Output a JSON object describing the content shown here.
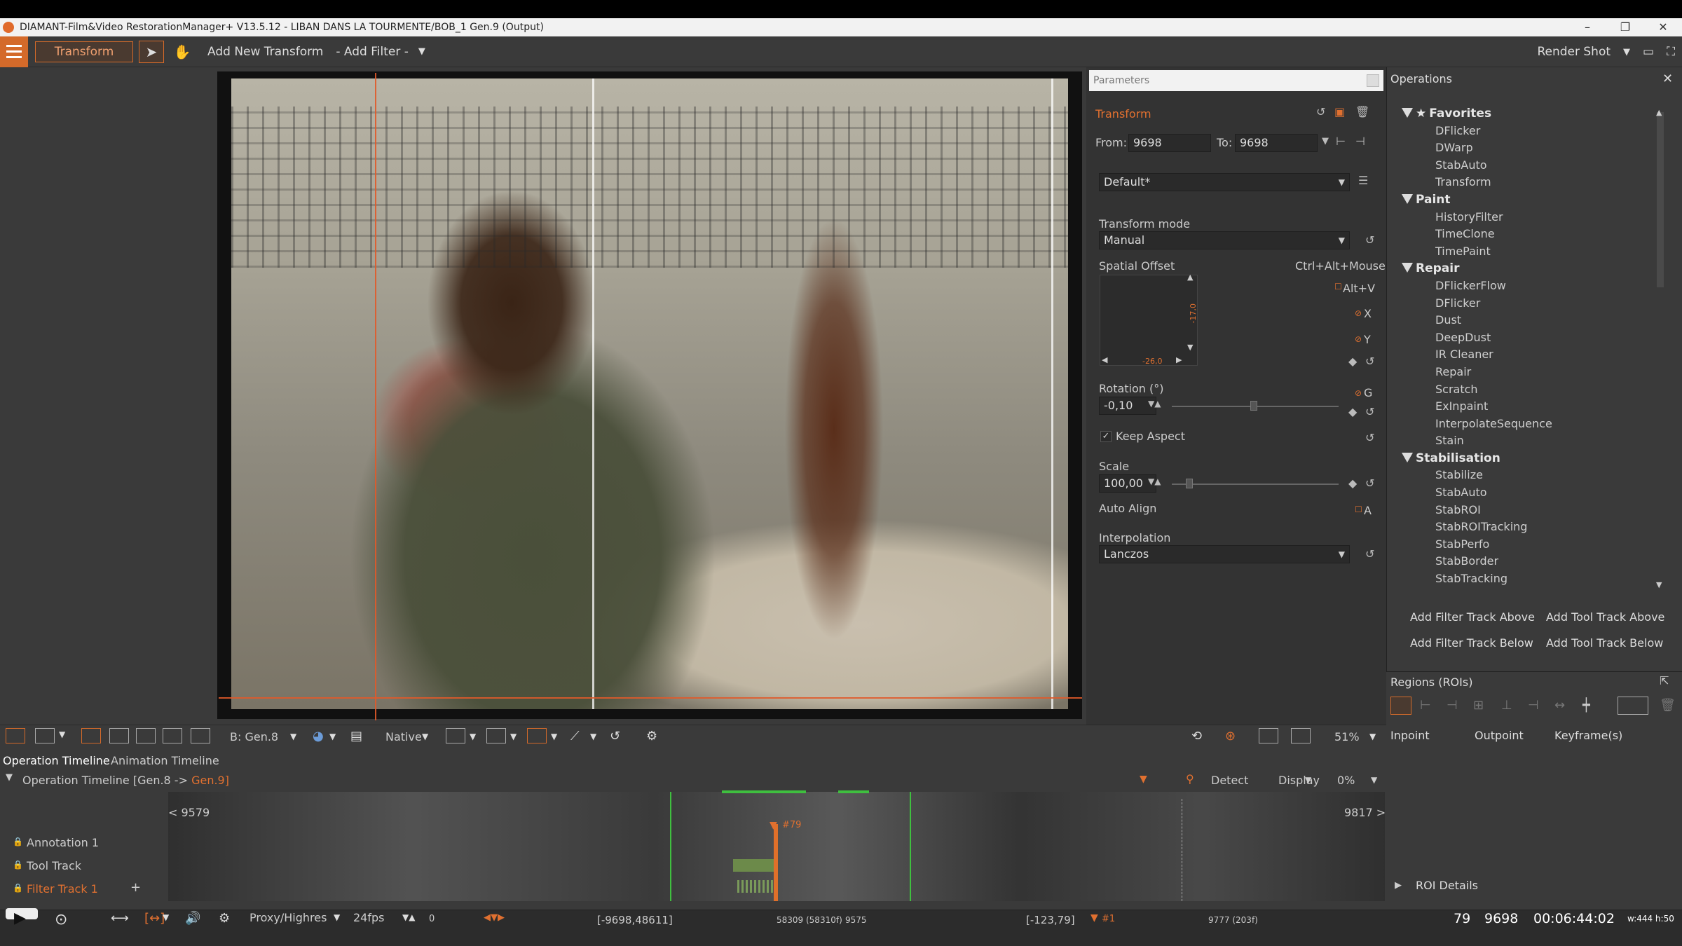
{
  "window": {
    "title": "DIAMANT-Film&Video RestorationManager+ V13.5.12 - LIBAN DANS LA TOURMENTE/BOB_1 Gen.9 (Output)",
    "buttons": [
      "–",
      "❐",
      "✕"
    ]
  },
  "toolbar": {
    "mode_label": "Transform",
    "add_new_transform": "Add New Transform",
    "add_filter": "- Add Filter -",
    "render_shot": "Render Shot"
  },
  "params": {
    "panel_title": "Parameters",
    "filter_name": "Transform",
    "from_label": "From:",
    "from_value": "9698",
    "to_label": "To:",
    "to_value": "9698",
    "preset": "Default*",
    "transform_mode_label": "Transform mode",
    "transform_mode_value": "Manual",
    "spatial_offset_label": "Spatial Offset",
    "spatial_offset_shortcut": "Ctrl+Alt+Mouse",
    "alt_v": "Alt+V",
    "x_key": "X",
    "y_key": "Y",
    "pad_x_value": "-26,0",
    "pad_y_value": "-17,0",
    "rotation_label": "Rotation (°)",
    "rotation_value": "-0,10",
    "rotation_key": "G",
    "keep_aspect": "Keep Aspect",
    "keep_aspect_checked": true,
    "scale_label": "Scale",
    "scale_value": "100,00",
    "auto_align_label": "Auto Align",
    "auto_align_key": "A",
    "interpolation_label": "Interpolation",
    "interpolation_value": "Lanczos"
  },
  "operations": {
    "title": "Operations",
    "categories": [
      {
        "name": "Favorites",
        "items": [
          "DFlicker",
          "DWarp",
          "StabAuto",
          "Transform"
        ]
      },
      {
        "name": "Paint",
        "items": [
          "HistoryFilter",
          "TimeClone",
          "TimePaint"
        ]
      },
      {
        "name": "Repair",
        "items": [
          "DFlickerFlow",
          "DFlicker",
          "Dust",
          "DeepDust",
          "IR Cleaner",
          "Repair",
          "Scratch",
          "ExInpaint",
          "InterpolateSequence",
          "Stain"
        ]
      },
      {
        "name": "Stabilisation",
        "items": [
          "Stabilize",
          "StabAuto",
          "StabROI",
          "StabROITracking",
          "StabPerfo",
          "StabBorder",
          "StabTracking"
        ]
      }
    ],
    "add_filter_above": "Add Filter Track Above",
    "add_tool_above": "Add Tool Track Above",
    "add_filter_below": "Add Filter Track Below",
    "add_tool_below": "Add Tool Track Below"
  },
  "regions": {
    "title": "Regions (ROIs)",
    "col_inpoint": "Inpoint",
    "col_outpoint": "Outpoint",
    "col_keyframes": "Keyframe(s)",
    "roi_details": "ROI Details"
  },
  "viewer_toolbar": {
    "b_gen": "B: Gen.8",
    "native": "Native",
    "zoom": "51%"
  },
  "timeline": {
    "tab_operation": "Operation Timeline",
    "tab_animation": "Animation Timeline",
    "header": "Operation Timeline [Gen.8 -> ",
    "header_gen": "Gen.9]",
    "detect": "Detect",
    "display": "Display",
    "percent": "0%",
    "start_frame": "< 9579",
    "end_frame": "9817 >",
    "marker": "#79",
    "tracks": [
      "Annotation 1",
      "Tool Track",
      "Filter Track 1"
    ],
    "add_track": "+"
  },
  "bottom": {
    "proxy": "Proxy/Highres",
    "fps": "24fps",
    "zero": "0",
    "range_left": "[-9698,48611]",
    "mid_a": "58309 (58310f)",
    "mid_b": "9575",
    "range_right": "[-123,79]",
    "marker_right": "#1",
    "end_info": "9777 (203f)",
    "frame_idx": "79",
    "frame_num": "9698",
    "timecode": "00:06:44:02",
    "size_info": "w:444 h:50"
  },
  "colors": {
    "accent": "#e07030",
    "selection_green": "#3fbf3f",
    "panel_bg": "#3a3a3a"
  }
}
